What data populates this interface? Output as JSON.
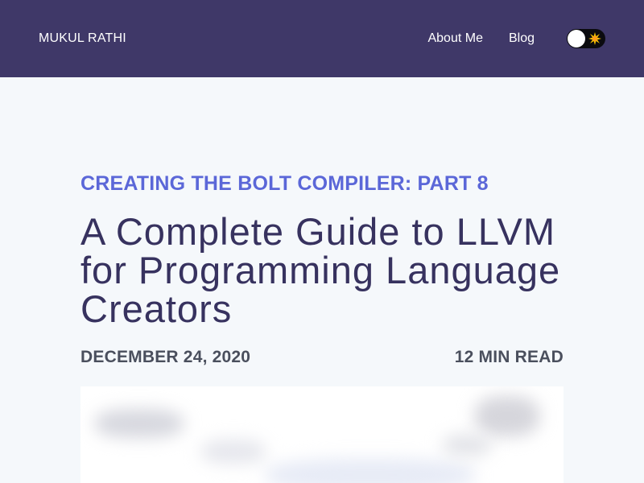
{
  "header": {
    "brand": "MUKUL RATHI",
    "nav": [
      {
        "label": "About Me"
      },
      {
        "label": "Blog"
      }
    ],
    "theme_toggle": {
      "icon": "sun-icon"
    }
  },
  "post": {
    "series": "CREATING THE BOLT COMPILER: PART 8",
    "title": "A Complete Guide to LLVM for Programming Language Creators",
    "date": "DECEMBER 24, 2020",
    "read_time": "12 MIN READ"
  },
  "colors": {
    "navbar": "#3f3868",
    "accent": "#5b67d8",
    "title": "#37325f",
    "meta": "#4a4f5d",
    "background": "#f5f8fb"
  }
}
